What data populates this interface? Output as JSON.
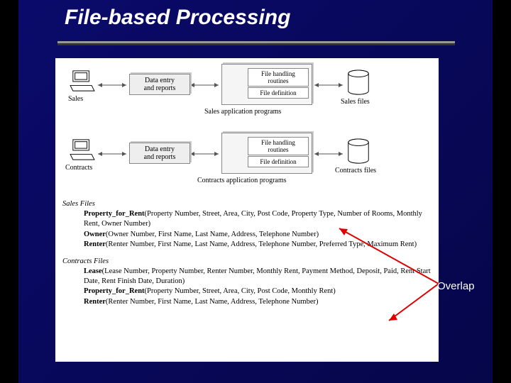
{
  "title": "File-based Processing",
  "overlap_label": "Overlap",
  "row1": {
    "terminal": "Sales",
    "data_entry": "Data entry\nand reports",
    "fh": "File handling routines",
    "fd": "File definition",
    "files": "Sales files",
    "app": "Sales application programs"
  },
  "row2": {
    "terminal": "Contracts",
    "data_entry": "Data entry\nand reports",
    "fh": "File handling routines",
    "fd": "File definition",
    "files": "Contracts files",
    "app": "Contracts application programs"
  },
  "schema": {
    "sales_hd": "Sales Files",
    "sales": [
      {
        "name": "Property_for_Rent",
        "fields": "(Property Number, Street, Area, City, Post Code, Property Type, Number of Rooms, Monthly Rent, Owner Number)"
      },
      {
        "name": "Owner",
        "fields": "(Owner Number, First Name, Last Name, Address, Telephone Number)"
      },
      {
        "name": "Renter",
        "fields": "(Renter Number, First Name, Last Name, Address, Telephone Number, Preferred Type, Maximum Rent)"
      }
    ],
    "contracts_hd": "Contracts Files",
    "contracts": [
      {
        "name": "Lease",
        "fields": "(Lease Number, Property Number, Renter Number, Monthly Rent, Payment Method, Deposit, Paid, Rent Start Date, Rent Finish Date, Duration)"
      },
      {
        "name": "Property_for_Rent",
        "fields": "(Property Number, Street, Area, City, Post Code, Monthly Rent)"
      },
      {
        "name": "Renter",
        "fields": "(Renter Number, First Name, Last Name, Address, Telephone Number)"
      }
    ]
  }
}
